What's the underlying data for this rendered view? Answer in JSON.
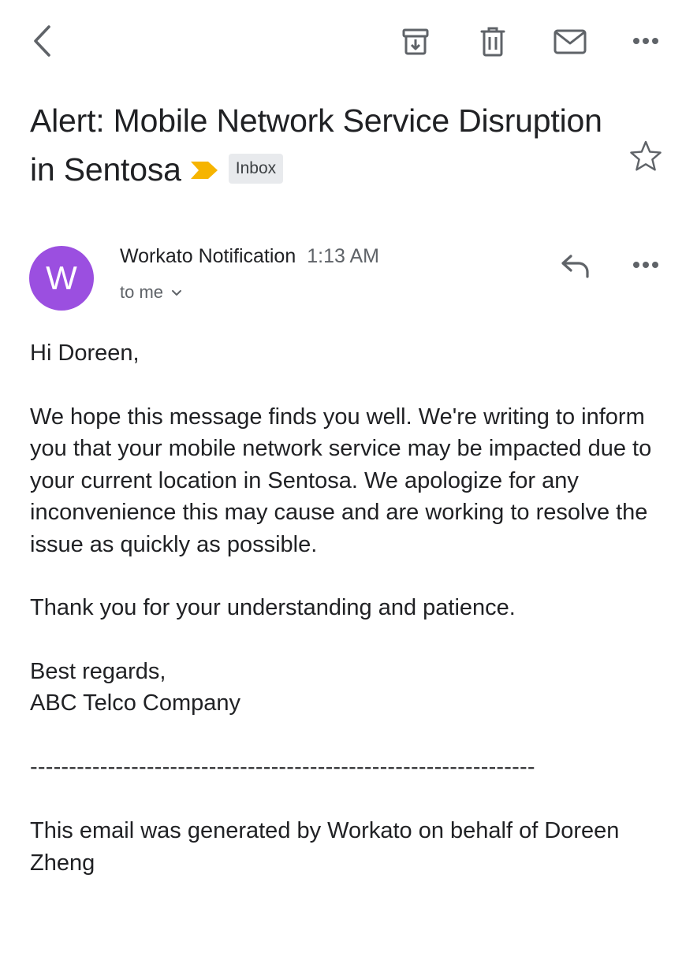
{
  "toolbar": {
    "back_icon": "chevron-left-icon",
    "archive_icon": "archive-icon",
    "delete_icon": "trash-icon",
    "mark_unread_icon": "envelope-icon",
    "more_icon": "more-horizontal-icon"
  },
  "email": {
    "subject": "Alert: Mobile Network Service Disruption in Sentosa",
    "importance_icon": "importance-marker-icon",
    "importance_color": "#f6b400",
    "label": "Inbox",
    "star_icon": "star-outline-icon",
    "sender": {
      "avatar_letter": "W",
      "avatar_color": "#9b4fe0",
      "name": "Workato Notification",
      "time": "1:13 AM",
      "recipient": "to me"
    },
    "reply_icon": "reply-icon",
    "message_more_icon": "more-horizontal-icon",
    "body": {
      "greeting": "Hi Doreen,",
      "paragraph1": "We hope this message finds you well. We're writing to inform you that your mobile network service may be impacted due to your current location in Sentosa. We apologize for any inconvenience this may cause and are working to resolve the issue as quickly as possible.",
      "paragraph2": "Thank you for your understanding and patience.",
      "signoff": "Best regards,",
      "signature": "ABC Telco Company",
      "divider": "-----------------------------------------------------------------",
      "footer": "This email was generated by Workato on behalf of Doreen Zheng"
    }
  }
}
